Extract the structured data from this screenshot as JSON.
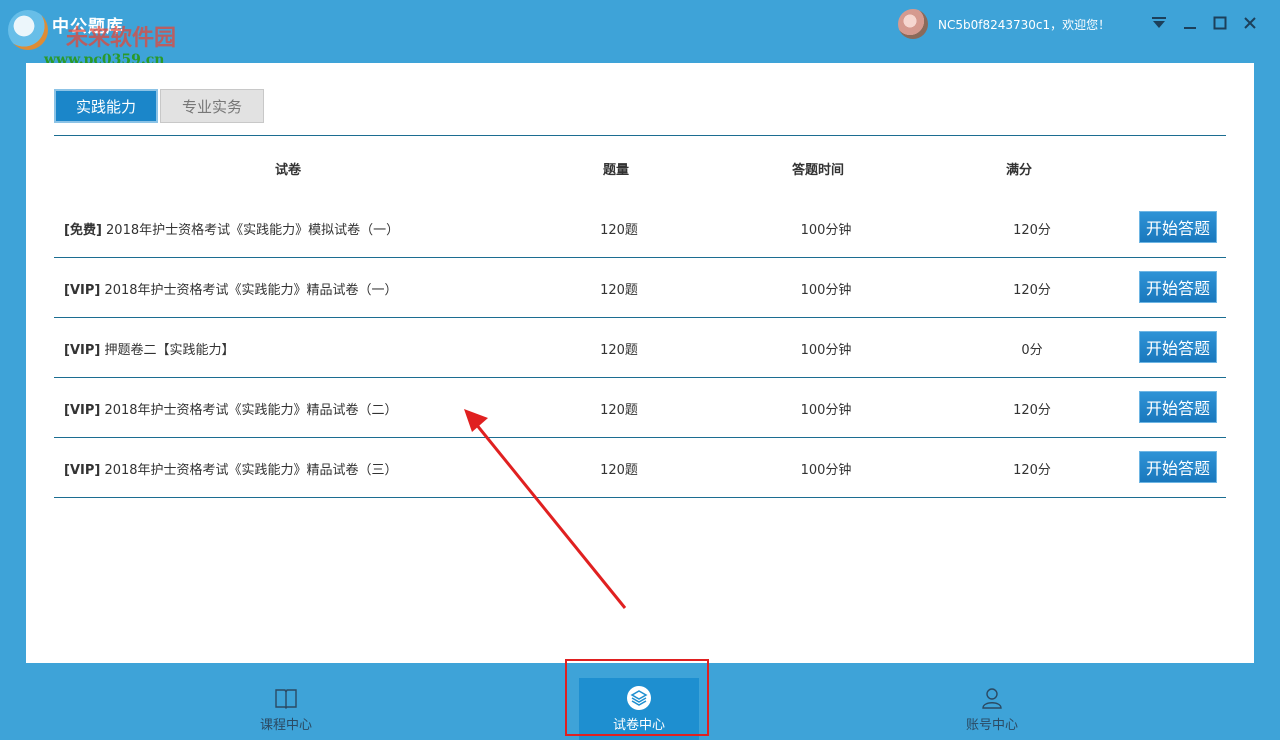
{
  "app": {
    "brand": "中公题库",
    "watermark_top": "未来软件园",
    "watermark_url": "www.pc0359.cn"
  },
  "header": {
    "user_greeting": "NC5b0f8243730c1，欢迎您！"
  },
  "tabs": [
    {
      "label": "实践能力",
      "active": true
    },
    {
      "label": "专业实务",
      "active": false
    }
  ],
  "table": {
    "columns": [
      "试卷",
      "题量",
      "答题时间",
      "满分"
    ],
    "rows": [
      {
        "tag": "[免费]",
        "title": "2018年护士资格考试《实践能力》模拟试卷（一）",
        "count": "120题",
        "time": "100分钟",
        "score": "120分",
        "action": "开始答题"
      },
      {
        "tag": "[VIP]",
        "title": "2018年护士资格考试《实践能力》精品试卷（一）",
        "count": "120题",
        "time": "100分钟",
        "score": "120分",
        "action": "开始答题"
      },
      {
        "tag": "[VIP]",
        "title": "押题卷二【实践能力】",
        "count": "120题",
        "time": "100分钟",
        "score": "0分",
        "action": "开始答题"
      },
      {
        "tag": "[VIP]",
        "title": "2018年护士资格考试《实践能力》精品试卷（二）",
        "count": "120题",
        "time": "100分钟",
        "score": "120分",
        "action": "开始答题"
      },
      {
        "tag": "[VIP]",
        "title": "2018年护士资格考试《实践能力》精品试卷（三）",
        "count": "120题",
        "time": "100分钟",
        "score": "120分",
        "action": "开始答题"
      }
    ]
  },
  "bottom_nav": [
    {
      "label": "课程中心",
      "icon": "book-icon",
      "active": false
    },
    {
      "label": "试卷中心",
      "icon": "layers-icon",
      "active": true
    },
    {
      "label": "账号中心",
      "icon": "user-icon",
      "active": false
    }
  ],
  "colors": {
    "chrome_blue": "#3ea3d8",
    "accent_blue": "#1b86c9",
    "annotation_red": "#e02020"
  }
}
